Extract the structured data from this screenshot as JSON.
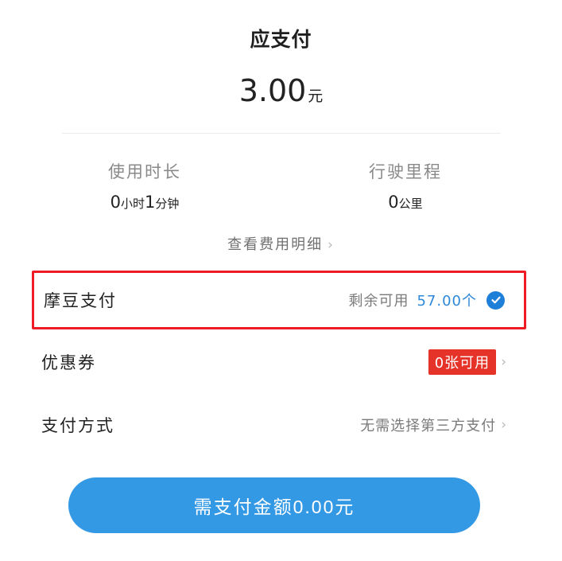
{
  "header": {
    "title": "应支付",
    "amount": "3.00",
    "amount_unit": "元"
  },
  "stats": {
    "duration": {
      "label": "使用时长",
      "hours": "0",
      "hours_unit": "小时",
      "minutes": "1",
      "minutes_unit": "分钟"
    },
    "distance": {
      "label": "行驶里程",
      "value": "0",
      "unit": "公里"
    }
  },
  "detail_link": {
    "label": "查看费用明细",
    "chevron": "›"
  },
  "modou": {
    "label": "摩豆支付",
    "remaining_label": "剩余可用",
    "remaining_value": "57.00个",
    "checked": true,
    "check_icon": "check-circle-icon"
  },
  "coupon": {
    "label": "优惠券",
    "badge": "0张可用",
    "chevron": "›"
  },
  "payment_method": {
    "label": "支付方式",
    "value": "无需选择第三方支付",
    "chevron": "›"
  },
  "pay_button": {
    "label": "需支付金额0.00元"
  },
  "colors": {
    "accent_blue": "#3499e4",
    "check_blue": "#1e7fd8",
    "badge_red": "#e6332a",
    "highlight_red": "#ee1c25"
  }
}
